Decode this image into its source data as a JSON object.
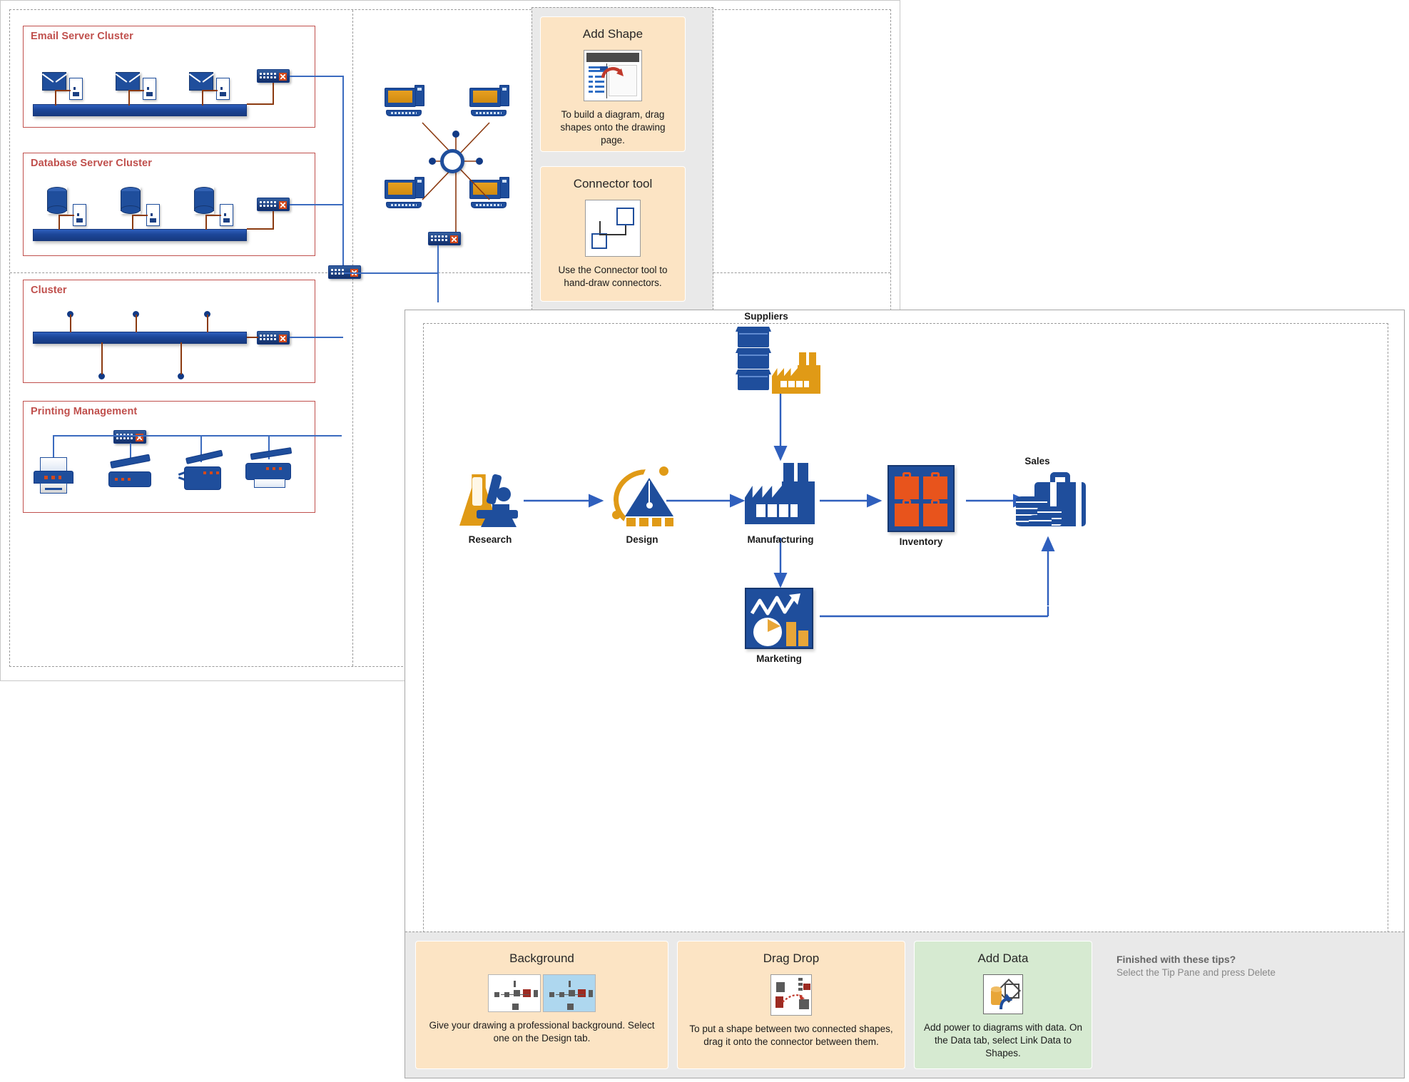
{
  "network_window": {
    "clusters": [
      {
        "title": "Email Server Cluster",
        "nodes": [
          "mail-server-1",
          "mail-server-2",
          "mail-server-3"
        ],
        "switch": "switch-email"
      },
      {
        "title": "Database Server Cluster",
        "nodes": [
          "db-server-1",
          "db-server-2",
          "db-server-3"
        ],
        "switch": "switch-database"
      },
      {
        "title": "Cluster",
        "nodes": [
          "node-1",
          "node-2",
          "node-3",
          "node-4",
          "node-5"
        ],
        "switch": "switch-cluster"
      },
      {
        "title": "Printing Management",
        "nodes": [
          "printer",
          "scanner",
          "copier",
          "multifunction-printer"
        ],
        "switch": "switch-printing"
      }
    ],
    "star_topology": {
      "hub": "ring-network-hub",
      "workstations": [
        "pc-top-left",
        "pc-top-right",
        "pc-bottom-left",
        "pc-bottom-right"
      ],
      "switch": "switch-star"
    },
    "core_switch": "switch-core"
  },
  "tip_pane_top": {
    "tips": [
      {
        "title": "Add Shape",
        "desc": "To build a diagram, drag shapes onto the drawing page.",
        "thumb": "add-shape-thumbnail",
        "accent": "#fce4c4"
      },
      {
        "title": "Connector tool",
        "desc": "Use the Connector tool to hand-draw connectors.",
        "thumb": "connector-tool-thumbnail",
        "accent": "#fce4c4"
      }
    ]
  },
  "supply_window": {
    "nodes": [
      {
        "id": "research",
        "label": "Research",
        "icon": "flask-microscope-icon"
      },
      {
        "id": "design",
        "label": "Design",
        "icon": "compass-design-icon"
      },
      {
        "id": "manufacturing",
        "label": "Manufacturing",
        "icon": "factory-icon"
      },
      {
        "id": "inventory",
        "label": "Inventory",
        "icon": "inventory-cases-icon"
      },
      {
        "id": "sales",
        "label": "Sales",
        "icon": "briefcase-coins-icon"
      },
      {
        "id": "marketing",
        "label": "Marketing",
        "icon": "marketing-chart-icon"
      },
      {
        "id": "suppliers",
        "label": "Suppliers",
        "icon": "supplier-crates-icon"
      }
    ],
    "flow": [
      {
        "from": "research",
        "to": "design"
      },
      {
        "from": "design",
        "to": "manufacturing"
      },
      {
        "from": "suppliers",
        "to": "manufacturing"
      },
      {
        "from": "manufacturing",
        "to": "inventory"
      },
      {
        "from": "manufacturing",
        "to": "marketing"
      },
      {
        "from": "inventory",
        "to": "sales"
      },
      {
        "from": "marketing",
        "to": "sales"
      }
    ]
  },
  "tip_pane_bottom": {
    "tips": [
      {
        "title": "Background",
        "desc": "Give your drawing a professional background. Select one on the Design tab.",
        "thumb": "background-thumbnail",
        "accent": "#fce4c4"
      },
      {
        "title": "Drag Drop",
        "desc": "To put a shape between two connected shapes, drag it onto the connector between them.",
        "thumb": "drag-drop-thumbnail",
        "accent": "#fce4c4"
      },
      {
        "title": "Add Data",
        "desc": "Add power to diagrams with data. On the Data tab, select Link Data to Shapes.",
        "thumb": "add-data-thumbnail",
        "accent": "#d6ead1"
      }
    ],
    "finished": {
      "title": "Finished with these tips?",
      "desc": "Select the Tip Pane and press Delete"
    }
  },
  "colors": {
    "cluster_border": "#c0504d",
    "shape_blue": "#1f4e9c",
    "accent_orange": "#e09a16",
    "connector_blue": "#2f5fbd",
    "tip_bg": "#fce4c4",
    "tip_bg_green": "#d6ead1"
  }
}
